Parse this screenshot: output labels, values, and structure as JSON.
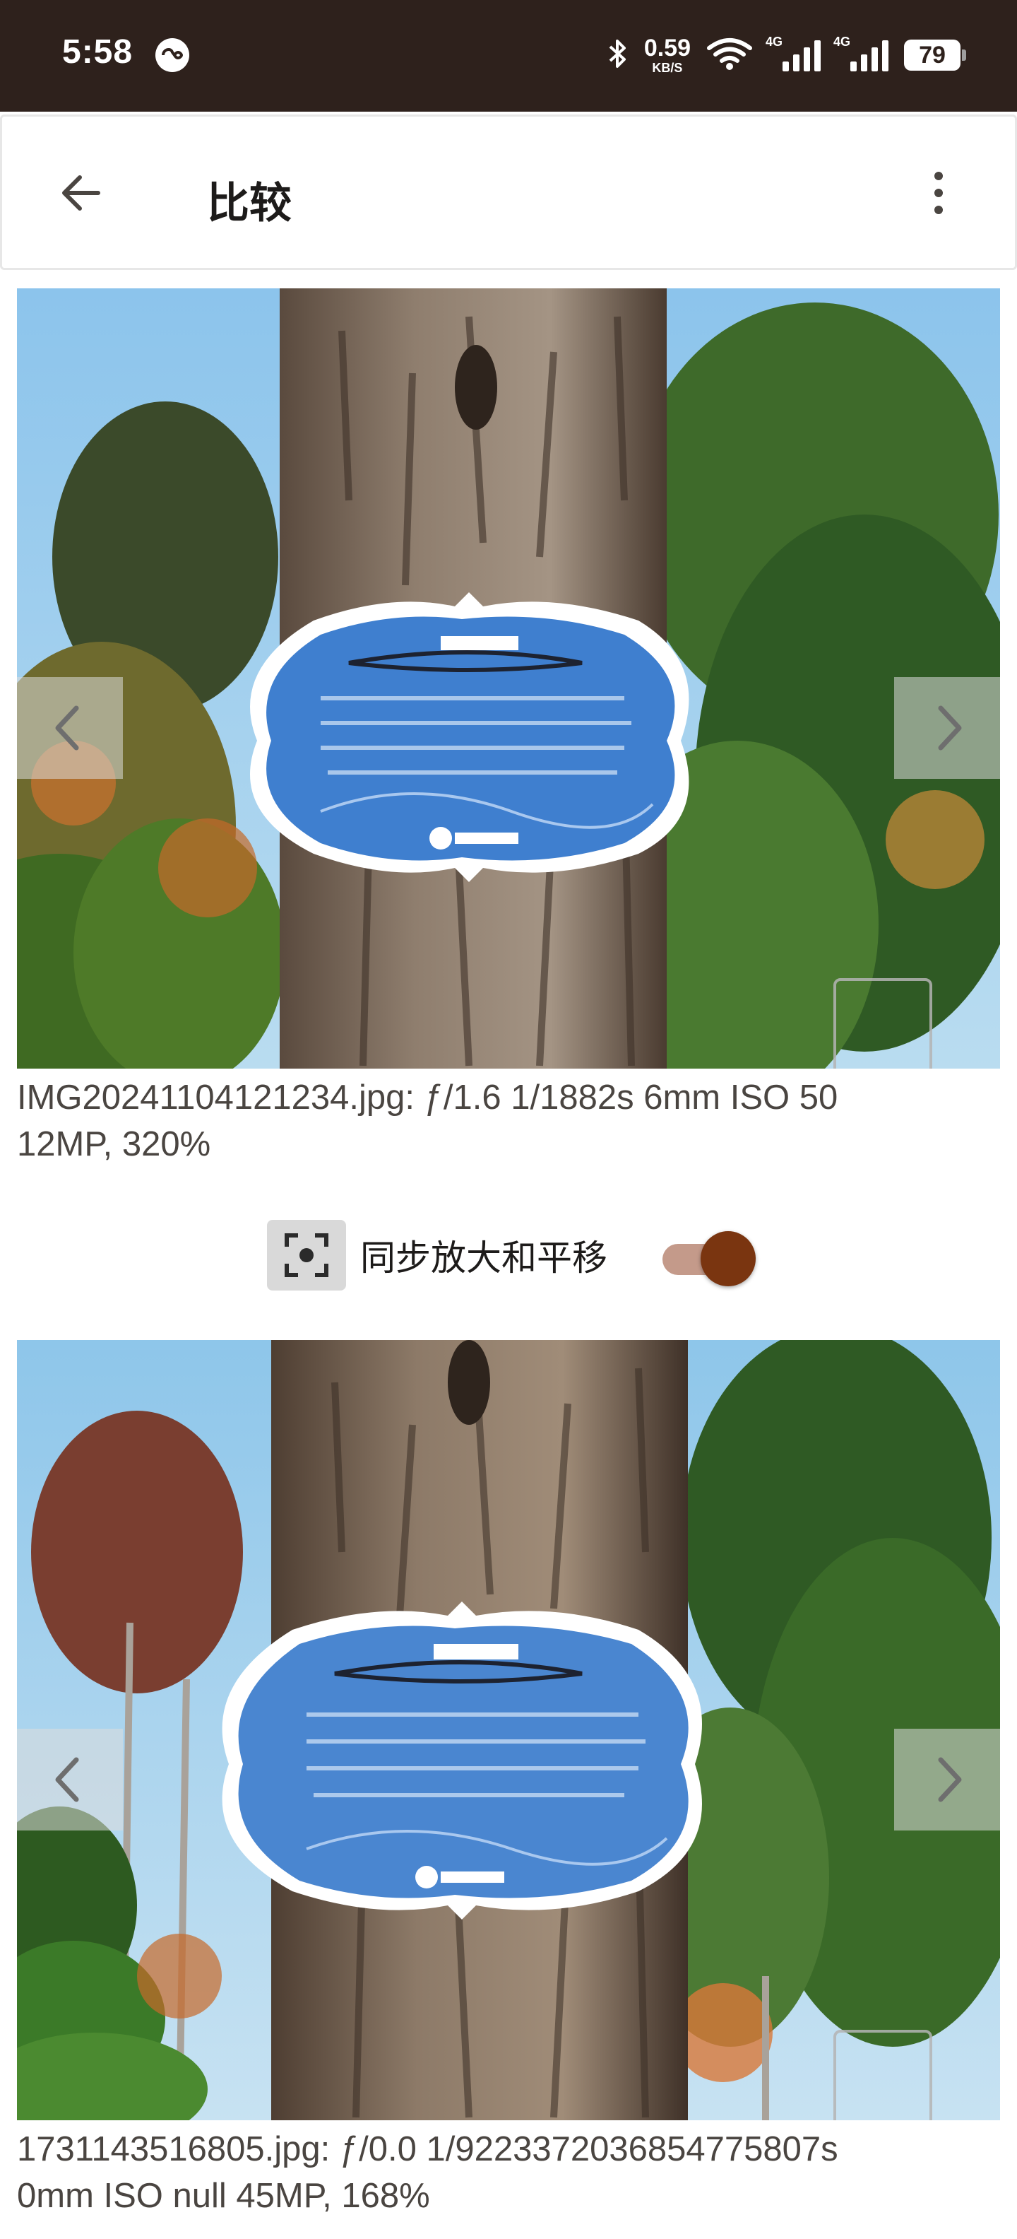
{
  "status_bar": {
    "time": "5:58",
    "network_speed_value": "0.59",
    "network_speed_unit": "KB/S",
    "signal_1_label": "4G",
    "signal_2_label": "4G",
    "battery": "79"
  },
  "app_bar": {
    "title": "比较"
  },
  "top_image": {
    "caption_line1": "IMG20241104121234.jpg: ƒ/1.6 1/1882s 6mm ISO 50",
    "caption_line2": "12MP, 320%"
  },
  "sync": {
    "label": "同步放大和平移",
    "enabled": true
  },
  "bottom_image": {
    "caption_line1": "1731143516805.jpg: ƒ/0.0 1/9223372036854775807s",
    "caption_line2": "0mm ISO null 45MP, 168%"
  },
  "colors": {
    "status_bar_bg": "#2e211c",
    "toggle_thumb": "#7a3510",
    "toggle_track": "#c49a8a",
    "sky": "#8ec6ea",
    "sign_blue": "#3f7fcf"
  }
}
